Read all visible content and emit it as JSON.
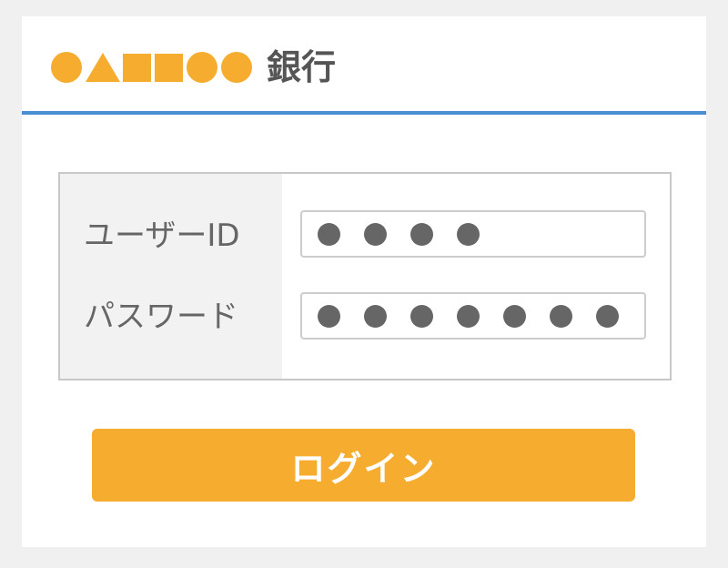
{
  "header": {
    "logo_shapes": [
      "circle",
      "triangle",
      "square",
      "square",
      "circle",
      "circle"
    ],
    "bank_name": "銀行",
    "accent_color": "#f6ad2f",
    "divider_color": "#4a8fd4"
  },
  "form": {
    "user_id": {
      "label": "ユーザーID",
      "masked_length": 4
    },
    "password": {
      "label": "パスワード",
      "masked_length": 7
    }
  },
  "login_button": {
    "label": "ログイン",
    "color": "#f6ad2f"
  }
}
